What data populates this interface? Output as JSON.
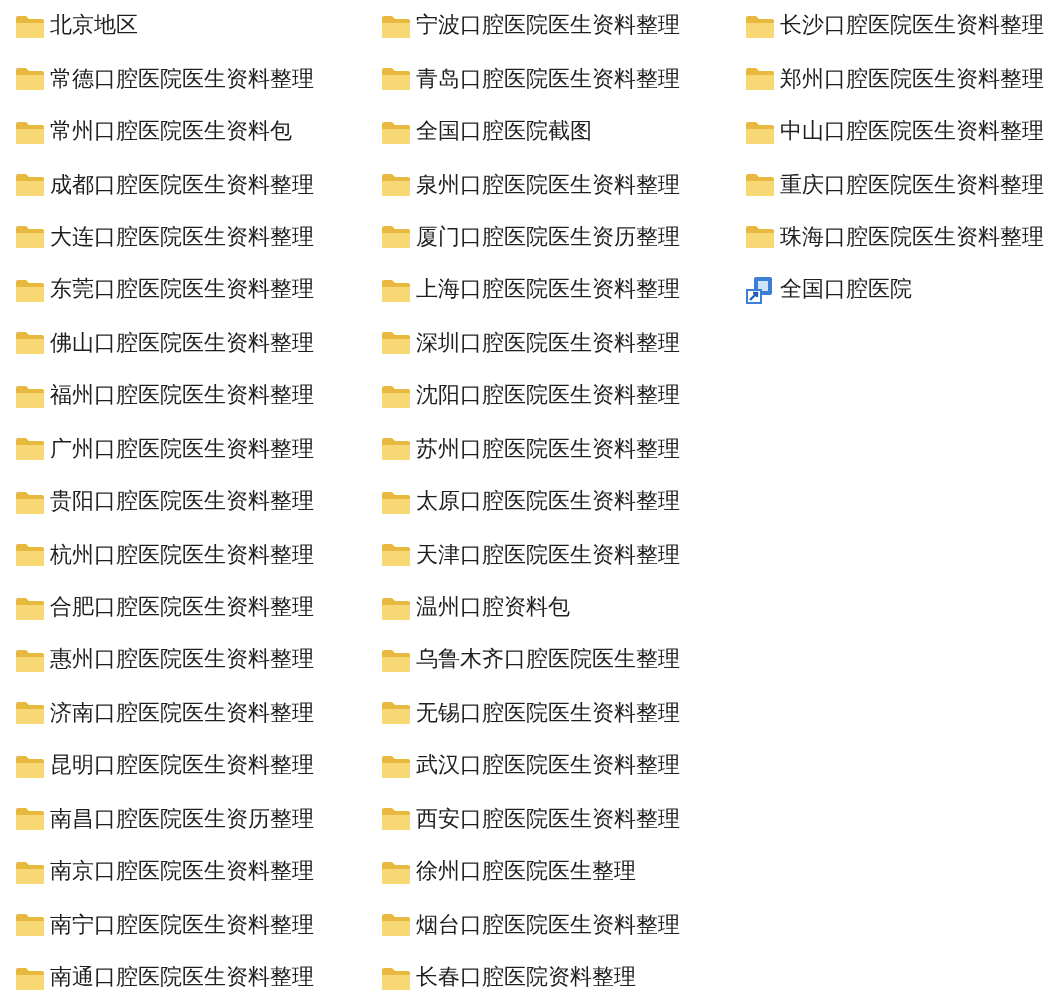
{
  "columns": [
    {
      "items": [
        {
          "kind": "folder",
          "name": "北京地区"
        },
        {
          "kind": "folder",
          "name": "常德口腔医院医生资料整理"
        },
        {
          "kind": "folder",
          "name": "常州口腔医院医生资料包"
        },
        {
          "kind": "folder",
          "name": "成都口腔医院医生资料整理"
        },
        {
          "kind": "folder",
          "name": "大连口腔医院医生资料整理"
        },
        {
          "kind": "folder",
          "name": "东莞口腔医院医生资料整理"
        },
        {
          "kind": "folder",
          "name": "佛山口腔医院医生资料整理"
        },
        {
          "kind": "folder",
          "name": "福州口腔医院医生资料整理"
        },
        {
          "kind": "folder",
          "name": "广州口腔医院医生资料整理"
        },
        {
          "kind": "folder",
          "name": "贵阳口腔医院医生资料整理"
        },
        {
          "kind": "folder",
          "name": "杭州口腔医院医生资料整理"
        },
        {
          "kind": "folder",
          "name": "合肥口腔医院医生资料整理"
        },
        {
          "kind": "folder",
          "name": "惠州口腔医院医生资料整理"
        },
        {
          "kind": "folder",
          "name": "济南口腔医院医生资料整理"
        },
        {
          "kind": "folder",
          "name": "昆明口腔医院医生资料整理"
        },
        {
          "kind": "folder",
          "name": "南昌口腔医院医生资历整理"
        },
        {
          "kind": "folder",
          "name": "南京口腔医院医生资料整理"
        },
        {
          "kind": "folder",
          "name": "南宁口腔医院医生资料整理"
        },
        {
          "kind": "folder",
          "name": "南通口腔医院医生资料整理"
        }
      ]
    },
    {
      "items": [
        {
          "kind": "folder",
          "name": "宁波口腔医院医生资料整理"
        },
        {
          "kind": "folder",
          "name": "青岛口腔医院医生资料整理"
        },
        {
          "kind": "folder",
          "name": "全国口腔医院截图"
        },
        {
          "kind": "folder",
          "name": "泉州口腔医院医生资料整理"
        },
        {
          "kind": "folder",
          "name": "厦门口腔医院医生资历整理"
        },
        {
          "kind": "folder",
          "name": "上海口腔医院医生资料整理"
        },
        {
          "kind": "folder",
          "name": "深圳口腔医院医生资料整理"
        },
        {
          "kind": "folder",
          "name": "沈阳口腔医院医生资料整理"
        },
        {
          "kind": "folder",
          "name": "苏州口腔医院医生资料整理"
        },
        {
          "kind": "folder",
          "name": "太原口腔医院医生资料整理"
        },
        {
          "kind": "folder",
          "name": "天津口腔医院医生资料整理"
        },
        {
          "kind": "folder",
          "name": "温州口腔资料包"
        },
        {
          "kind": "folder",
          "name": "乌鲁木齐口腔医院医生整理"
        },
        {
          "kind": "folder",
          "name": "无锡口腔医院医生资料整理"
        },
        {
          "kind": "folder",
          "name": "武汉口腔医院医生资料整理"
        },
        {
          "kind": "folder",
          "name": "西安口腔医院医生资料整理"
        },
        {
          "kind": "folder",
          "name": "徐州口腔医院医生整理"
        },
        {
          "kind": "folder",
          "name": "烟台口腔医院医生资料整理"
        },
        {
          "kind": "folder",
          "name": "长春口腔医院资料整理"
        }
      ]
    },
    {
      "items": [
        {
          "kind": "folder",
          "name": "长沙口腔医院医生资料整理"
        },
        {
          "kind": "folder",
          "name": "郑州口腔医院医生资料整理"
        },
        {
          "kind": "folder",
          "name": "中山口腔医院医生资料整理"
        },
        {
          "kind": "folder",
          "name": "重庆口腔医院医生资料整理"
        },
        {
          "kind": "folder",
          "name": "珠海口腔医院医生资料整理"
        },
        {
          "kind": "shortcut",
          "name": "全国口腔医院"
        }
      ]
    }
  ]
}
